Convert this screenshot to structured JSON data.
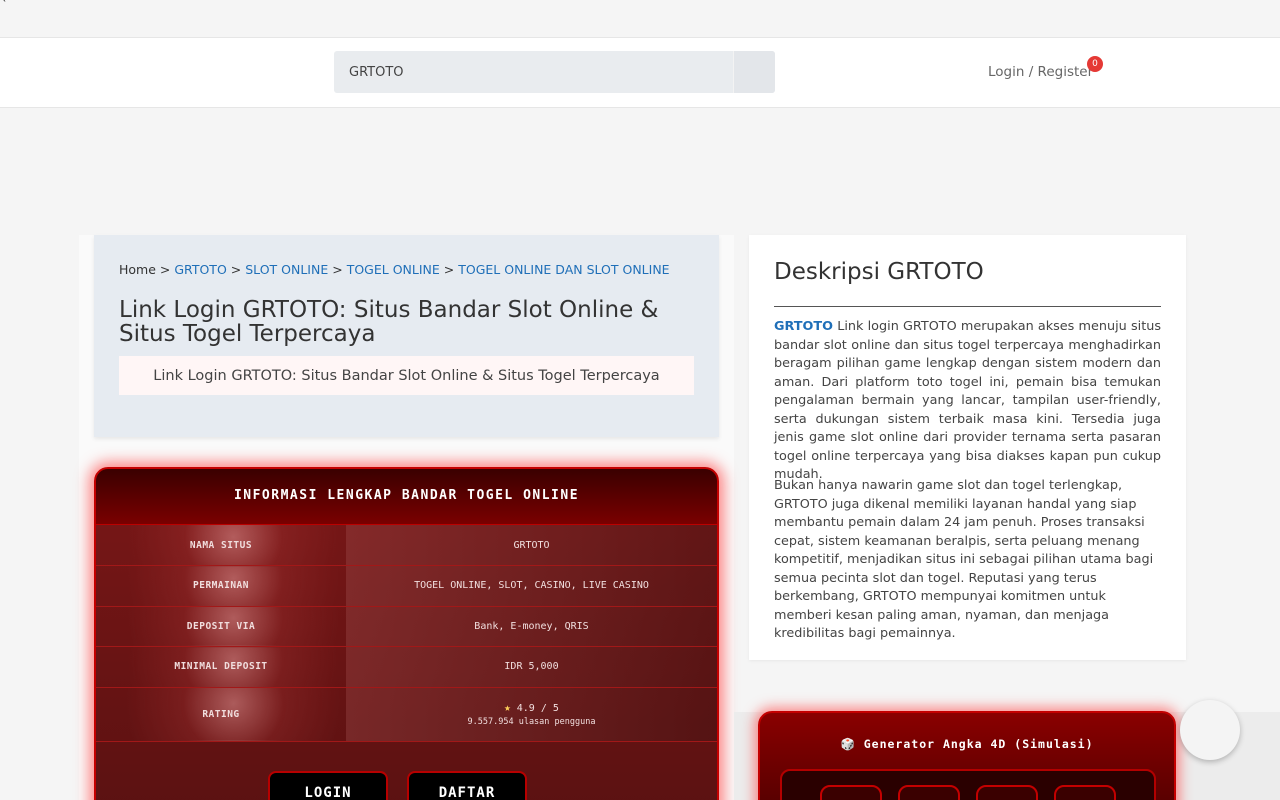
{
  "corner_mark": "`",
  "header": {
    "search_value": "GRTOTO",
    "login_label": "Login / Register",
    "cart_count": "0"
  },
  "breadcrumb": {
    "home": "Home",
    "sep": ">",
    "items": [
      "GRTOTO",
      "SLOT ONLINE",
      "TOGEL ONLINE",
      "TOGEL ONLINE DAN SLOT ONLINE"
    ]
  },
  "page_title": "Link Login GRTOTO: Situs Bandar Slot Online & Situs Togel Terpercaya",
  "banner_alt": "Link Login GRTOTO: Situs Bandar Slot Online & Situs Togel Terpercaya",
  "info": {
    "heading": "INFORMASI LENGKAP BANDAR TOGEL ONLINE",
    "rows": [
      {
        "label": "NAMA SITUS",
        "value": "GRTOTO"
      },
      {
        "label": "PERMAINAN",
        "value": "TOGEL ONLINE, SLOT, CASINO, LIVE CASINO"
      },
      {
        "label": "DEPOSIT VIA",
        "value": "Bank, E-money, QRIS"
      },
      {
        "label": "MINIMAL DEPOSIT",
        "value": "IDR 5,000"
      }
    ],
    "rating_label": "RATING",
    "rating_value": "4.9 / 5",
    "rating_score": 4.9,
    "reviews": "9.557.954 ulasan pengguna",
    "login_button": "LOGIN",
    "register_button": "DAFTAR"
  },
  "description": {
    "title": "Deskripsi GRTOTO",
    "link_text": "GRTOTO",
    "p1_rest": "Link login GRTOTO merupakan akses menuju situs bandar slot online dan situs togel terpercaya menghadirkan beragam pilihan game lengkap dengan sistem modern dan aman. Dari platform toto togel ini, pemain bisa temukan pengalaman bermain yang lancar, tampilan user-friendly, serta dukungan sistem terbaik masa kini. Tersedia juga jenis game slot online dari provider ternama serta pasaran togel online terpercaya yang bisa diakses kapan pun cukup mudah.",
    "p2": "Bukan hanya nawarin game slot dan togel terlengkap, GRTOTO juga dikenal memiliki layanan handal yang siap membantu pemain dalam 24 jam penuh. Proses transaksi cepat, sistem keamanan beralpis, serta peluang menang kompetitif, menjadikan situs ini sebagai pilihan utama bagi semua pecinta slot dan togel. Reputasi yang terus berkembang, GRTOTO mempunyai komitmen untuk memberi kesan paling aman, nyaman, dan menjaga kredibilitas bagi pemainnya."
  },
  "generator": {
    "title": "🎲 Generator Angka 4D (Simulasi)"
  }
}
